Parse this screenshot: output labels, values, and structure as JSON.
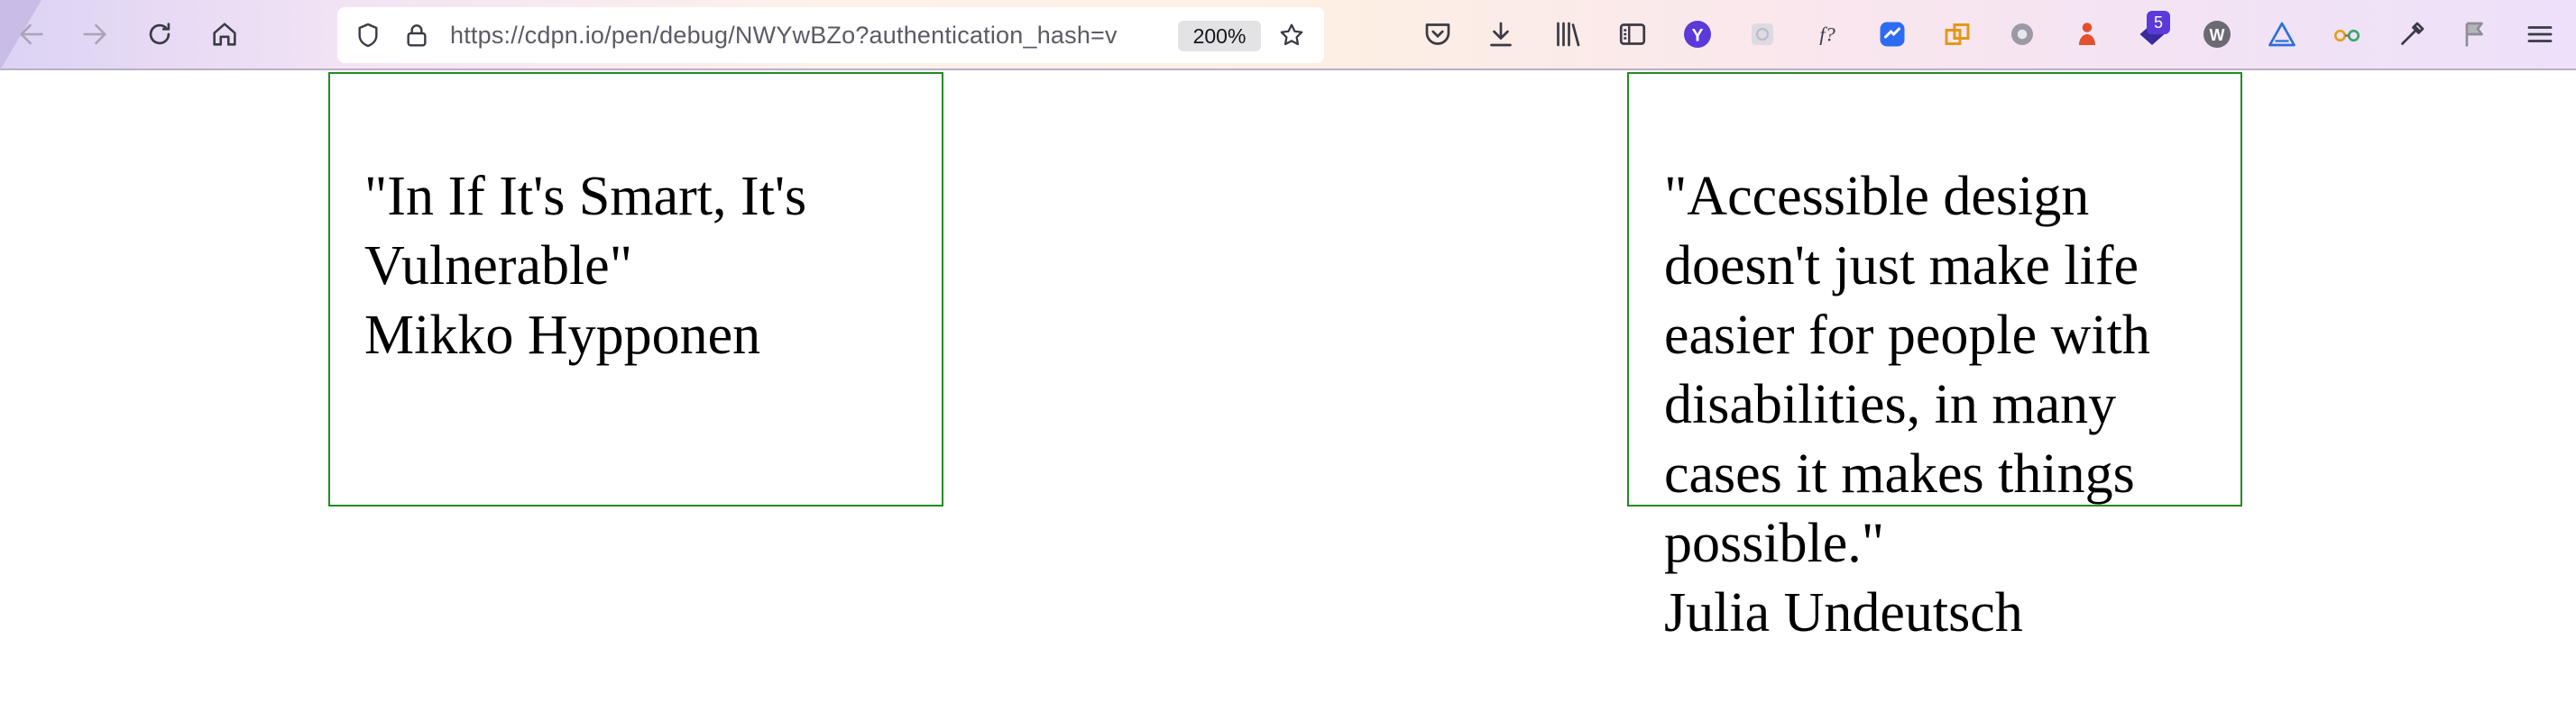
{
  "browser": {
    "url": "https://cdpn.io/pen/debug/NWYwBZo?authentication_hash=v",
    "zoom": "200%",
    "badge_count": "5",
    "icons": [
      "back-arrow-icon",
      "forward-arrow-icon",
      "reload-icon",
      "home-icon",
      "shield-icon",
      "lock-icon",
      "bookmark-star-icon",
      "pocket-icon",
      "download-icon",
      "library-icon",
      "sidebar-icon",
      "extension-y-icon",
      "extension-grid-icon",
      "fx-icon",
      "extension-link-icon",
      "extension-windows-icon",
      "gear-icon",
      "extension-figure-icon",
      "extension-badge-icon",
      "extension-w-icon",
      "extension-triangle-icon",
      "glasses-icon",
      "eyedropper-icon",
      "flag-icon",
      "menu-icon"
    ]
  },
  "quotes": [
    {
      "text": "\"In If It's Smart, It's Vulnerable\"",
      "author": "Mikko Hypponen"
    },
    {
      "text": "\"Accessible design doesn't just make life easier for people with disabilities, in many cases it makes things possible.\"",
      "author": "Julia Undeutsch"
    }
  ],
  "colors": {
    "box_border": "#228b22",
    "badge": "#5b3ad9",
    "accent": "#5b3ad9"
  }
}
